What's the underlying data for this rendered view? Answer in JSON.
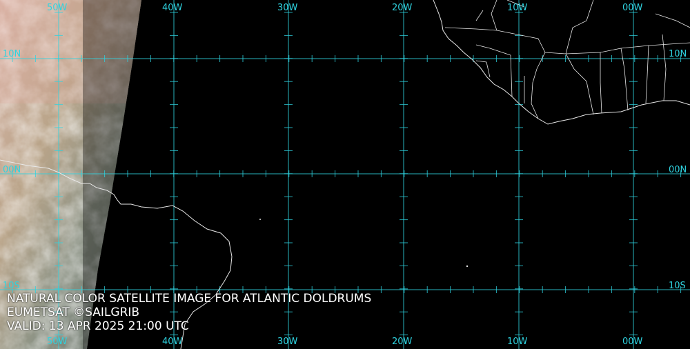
{
  "map": {
    "colors": {
      "grid": "#2fd3e0",
      "coast": "#e8e8e8",
      "ocean": "#000000"
    },
    "longitude_labels": [
      "50W",
      "40W",
      "30W",
      "20W",
      "10W",
      "00W"
    ],
    "latitude_labels": [
      "10N",
      "00N",
      "10S"
    ]
  },
  "caption": {
    "title": "NATURAL COLOR SATELLITE IMAGE FOR ATLANTIC DOLDRUMS",
    "credit": "EUMETSAT ©SAILGRIB",
    "valid": "VALID:  13 APR 2025 21:00 UTC"
  }
}
